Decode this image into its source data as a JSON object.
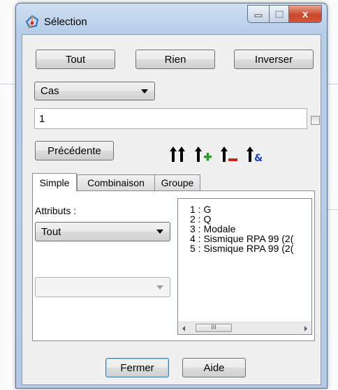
{
  "window": {
    "title": "Sélection",
    "icon": "selection-app-icon",
    "caption_buttons": [
      "minimize",
      "maximize",
      "close"
    ],
    "close_glyph": "x"
  },
  "toolbar": {
    "all_label": "Tout",
    "none_label": "Rien",
    "invert_label": "Inverser"
  },
  "type_select": {
    "value": "Cas"
  },
  "selection_input": {
    "value": "1"
  },
  "previous_label": "Précédente",
  "icon_buttons": [
    "double-up-arrow-icon",
    "up-arrow-plus-icon",
    "up-arrow-minus-icon",
    "up-arrow-and-icon"
  ],
  "tabs": [
    {
      "label": "Simple",
      "active": true
    },
    {
      "label": "Combinaison",
      "active": false
    },
    {
      "label": "Groupe",
      "active": false
    }
  ],
  "panel": {
    "attributes_label": "Attributs :",
    "attributes_select": "Tout",
    "secondary_select": "",
    "list_items": [
      "1 : G",
      "2 : Q",
      "3 : Modale",
      "4 : Sismique RPA 99 (2(",
      "5 : Sismique RPA 99 (2("
    ],
    "scroll_thumb": "III"
  },
  "footer": {
    "close_label": "Fermer",
    "help_label": "Aide"
  },
  "colors": {
    "frame": "#b7cde8",
    "client": "#f0f0f0",
    "close_button": "#c9482a",
    "default_button_border": "#3c7fb1",
    "plus_green": "#2e9a2e",
    "minus_red": "#d21f1f",
    "and_blue": "#1e3fd0"
  }
}
